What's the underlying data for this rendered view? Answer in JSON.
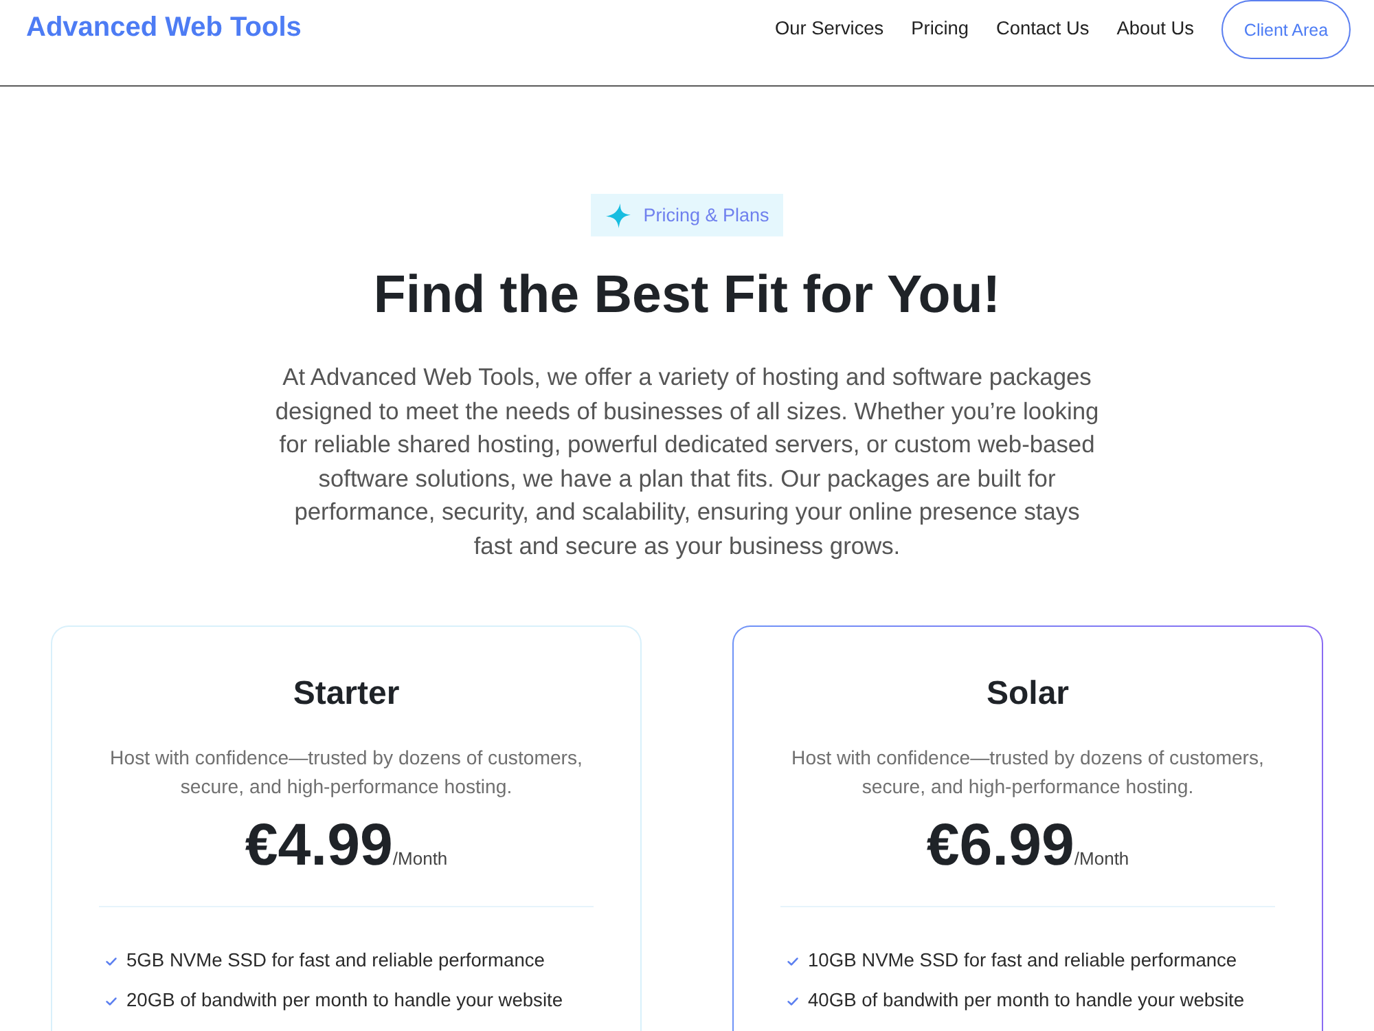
{
  "header": {
    "logo": "Advanced Web Tools",
    "nav": [
      "Our Services",
      "Pricing",
      "Contact Us",
      "About Us"
    ],
    "cta": "Client Area"
  },
  "hero": {
    "badge": "Pricing & Plans",
    "title": "Find the Best Fit for You!",
    "description": "At Advanced Web Tools, we offer a variety of hosting and software packages designed to meet the needs of businesses of all sizes. Whether you’re looking for reliable shared hosting, powerful dedicated servers, or custom web-based software solutions, we have a plan that fits. Our packages are built for performance, security, and scalability, ensuring your online presence stays fast and secure as your business grows."
  },
  "plans": [
    {
      "name": "Starter",
      "highlighted": false,
      "description": "Host with confidence—trusted by dozens of customers, secure, and high-performance hosting.",
      "price": "€4.99",
      "period": "/Month",
      "features": [
        "5GB NVMe SSD for fast and reliable performance",
        "20GB of bandwith per month to handle your website"
      ]
    },
    {
      "name": "Solar",
      "highlighted": true,
      "description": "Host with confidence—trusted by dozens of customers, secure, and high-performance hosting.",
      "price": "€6.99",
      "period": "/Month",
      "features": [
        "10GB NVMe SSD for fast and reliable performance",
        "40GB of bandwith per month to handle your website"
      ]
    }
  ]
}
